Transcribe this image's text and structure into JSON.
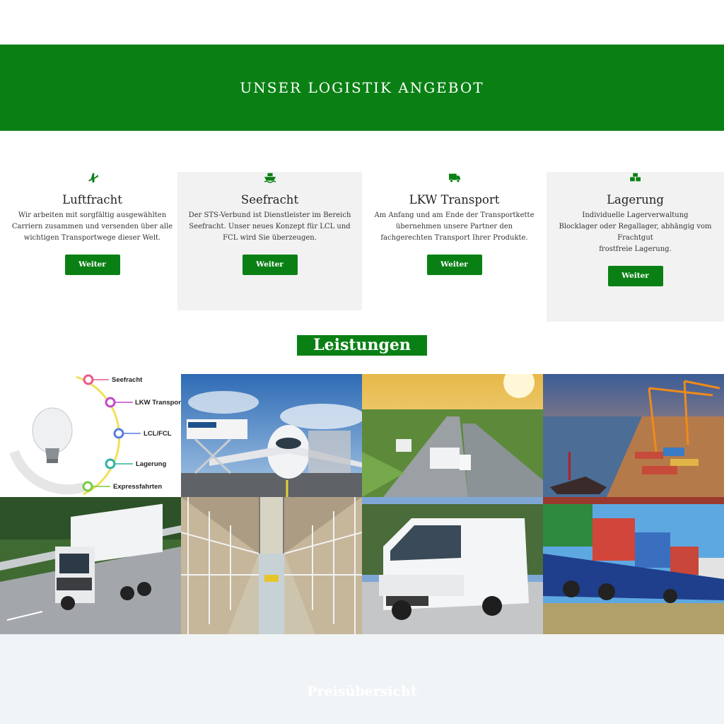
{
  "banner": {
    "title": "UNSER LOGISTIK ANGEBOT"
  },
  "colors": {
    "brand_green": "#0a8014",
    "card_bg": "#f2f2f2",
    "footer_bg": "#f0f4f7"
  },
  "cards": [
    {
      "icon": "airplane-icon",
      "title": "Luftfracht",
      "lines": [
        "Wir arbeiten mit sorgfältig ausgewählten",
        "Carriern zusammen und versenden über alle",
        "wichtigen Transportwege dieser Welt."
      ],
      "button": "Weiter"
    },
    {
      "icon": "ship-icon",
      "title": "Seefracht",
      "lines": [
        "Der STS-Verbund ist Dienstleister im Bereich",
        "Seefracht. Unser neues Konzept für LCL und",
        "FCL wird Sie überzeugen."
      ],
      "button": "Weiter"
    },
    {
      "icon": "truck-icon",
      "title": "LKW Transport",
      "lines": [
        "Am Anfang und am Ende der Transportkette",
        "übernehmen unsere Partner den",
        "fachgerechten Transport Ihrer Produkte."
      ],
      "button": "Weiter"
    },
    {
      "icon": "boxes-icon",
      "title": "Lagerung",
      "lines": [
        "Individuelle Lagerverwaltung",
        "Blocklager oder Regallager, abhängig vom",
        "Frachtgut",
        "frostfreie Lagerung."
      ],
      "button": "Weiter"
    }
  ],
  "services": {
    "heading": "Leistungen",
    "diagram_items": [
      "Seefracht",
      "LKW Transport",
      "LCL/FCL",
      "Lagerung",
      "Expressfahrten"
    ],
    "tiles": [
      "lightbulb-diagram",
      "airplane-photo",
      "highway-truck-photo",
      "container-port-photo",
      "volvo-truck-photo",
      "warehouse-photo",
      "white-van-photo",
      "container-train-photo"
    ]
  },
  "pricing": {
    "heading": "Preisübersicht"
  }
}
